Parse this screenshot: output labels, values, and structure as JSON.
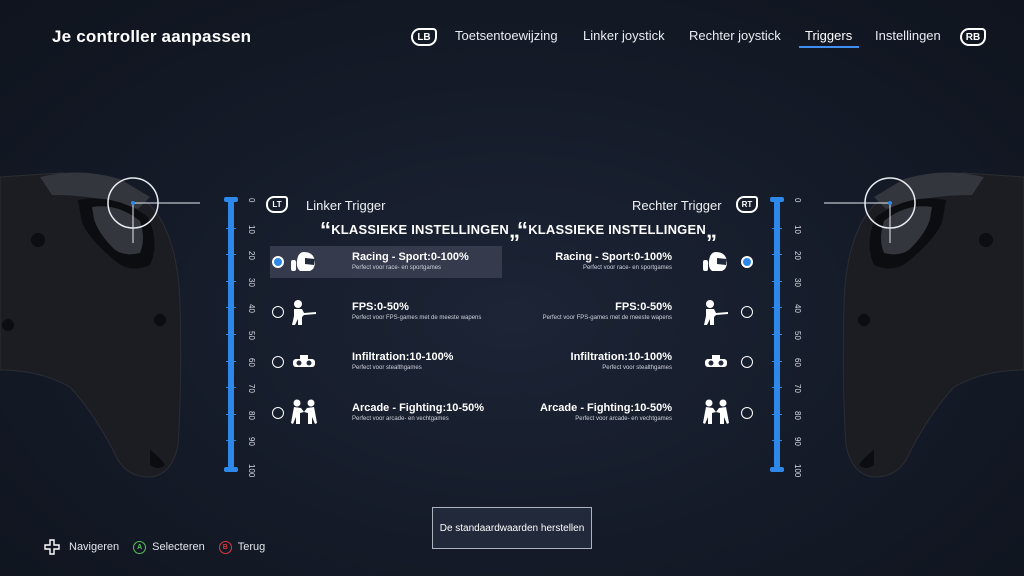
{
  "header": {
    "title": "Je controller aanpassen",
    "bumper_left": "LB",
    "bumper_right": "RB",
    "tabs": [
      {
        "label": "Toetsentoewijzing"
      },
      {
        "label": "Linker joystick"
      },
      {
        "label": "Rechter joystick"
      },
      {
        "label": "Triggers",
        "active": true
      },
      {
        "label": "Instellingen"
      }
    ]
  },
  "scale": [
    "0",
    "10",
    "20",
    "30",
    "40",
    "50",
    "60",
    "70",
    "80",
    "90",
    "100"
  ],
  "left_trigger": {
    "badge": "LT",
    "label": "Linker Trigger",
    "section_title": "KLASSIEKE INSTELLINGEN",
    "selected_index": 0,
    "options": [
      {
        "name": "Racing - Sport:0-100%",
        "desc": "Perfect voor race- en sportgames",
        "icon": "racing-helmet-icon"
      },
      {
        "name": "FPS:0-50%",
        "desc": "Perfect voor FPS-games met de meeste wapens",
        "icon": "shooter-icon"
      },
      {
        "name": "Infiltration:10-100%",
        "desc": "Perfect voor stealthgames",
        "icon": "night-vision-icon"
      },
      {
        "name": "Arcade - Fighting:10-50%",
        "desc": "Perfect voor arcade- en vechtgames",
        "icon": "fighters-icon"
      }
    ]
  },
  "right_trigger": {
    "badge": "RT",
    "label": "Rechter Trigger",
    "section_title": "KLASSIEKE INSTELLINGEN",
    "selected_index": 0,
    "options": [
      {
        "name": "Racing - Sport:0-100%",
        "desc": "Perfect voor race- en sportgames",
        "icon": "racing-helmet-icon"
      },
      {
        "name": "FPS:0-50%",
        "desc": "Perfect voor FPS-games met de meeste wapens",
        "icon": "shooter-icon"
      },
      {
        "name": "Infiltration:10-100%",
        "desc": "Perfect voor stealthgames",
        "icon": "night-vision-icon"
      },
      {
        "name": "Arcade - Fighting:10-50%",
        "desc": "Perfect voor arcade- en vechtgames",
        "icon": "fighters-icon"
      }
    ]
  },
  "reset_button": "De standaardwaarden herstellen",
  "footer": {
    "navigate": "Navigeren",
    "select_glyph": "A",
    "select": "Selecteren",
    "back_glyph": "B",
    "back": "Terug"
  },
  "colors": {
    "accent": "#2d88ea",
    "select_green": "#5cc05a",
    "back_red": "#e0383e"
  }
}
